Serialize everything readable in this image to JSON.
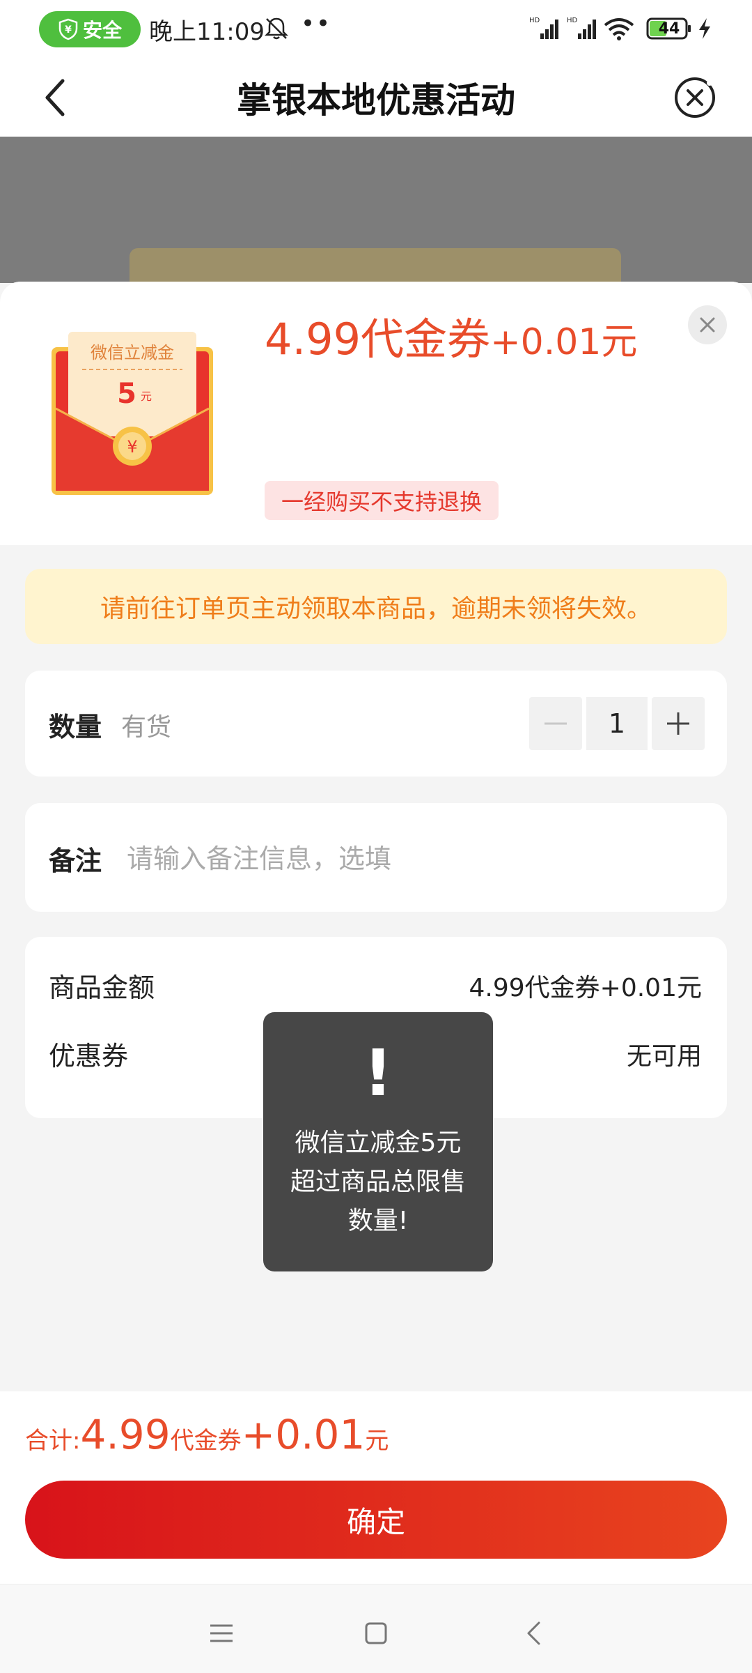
{
  "status_bar": {
    "safe_label": "安全",
    "time": "晚上11:09",
    "dots": "••",
    "battery": "44",
    "icons": [
      "shield-icon",
      "bell-muted-icon",
      "signal-icon",
      "wifi-icon",
      "battery-icon",
      "charging-icon"
    ]
  },
  "header": {
    "title": "掌银本地优惠活动",
    "back_icon": "chevron-left-icon",
    "close_icon": "close-circle-icon"
  },
  "product": {
    "image_title": "微信立减金",
    "image_amount": "5",
    "image_unit": "元",
    "price_main": "4.99代金券",
    "price_plus": "+0.01元",
    "no_refund": "一经购买不支持退换"
  },
  "notice": "请前往订单页主动领取本商品，逾期未领将失效。",
  "quantity": {
    "label": "数量",
    "stock": "有货",
    "value": "1"
  },
  "note": {
    "label": "备注",
    "placeholder": "请输入备注信息，选填"
  },
  "summary": {
    "amount_label": "商品金额",
    "amount_value": "4.99代金券+0.01元",
    "coupon_label": "优惠券",
    "coupon_value": "无可用"
  },
  "toast": {
    "icon": "!",
    "message": "微信立减金5元 超过商品总限售数量!"
  },
  "footer": {
    "total_label": "合计:",
    "total_num1": "4.99",
    "total_unit1": "代金券",
    "total_plus": "+",
    "total_num2": "0.01",
    "total_unit2": "元",
    "confirm": "确定"
  },
  "nav": [
    "menu-icon",
    "home-icon",
    "back-icon"
  ],
  "colors": {
    "accent_red": "#e84c2a",
    "button_red": "#d8131a",
    "notice_bg": "#fff4cf",
    "notice_text": "#ef7d1a",
    "safe_green": "#4fbf3e"
  }
}
